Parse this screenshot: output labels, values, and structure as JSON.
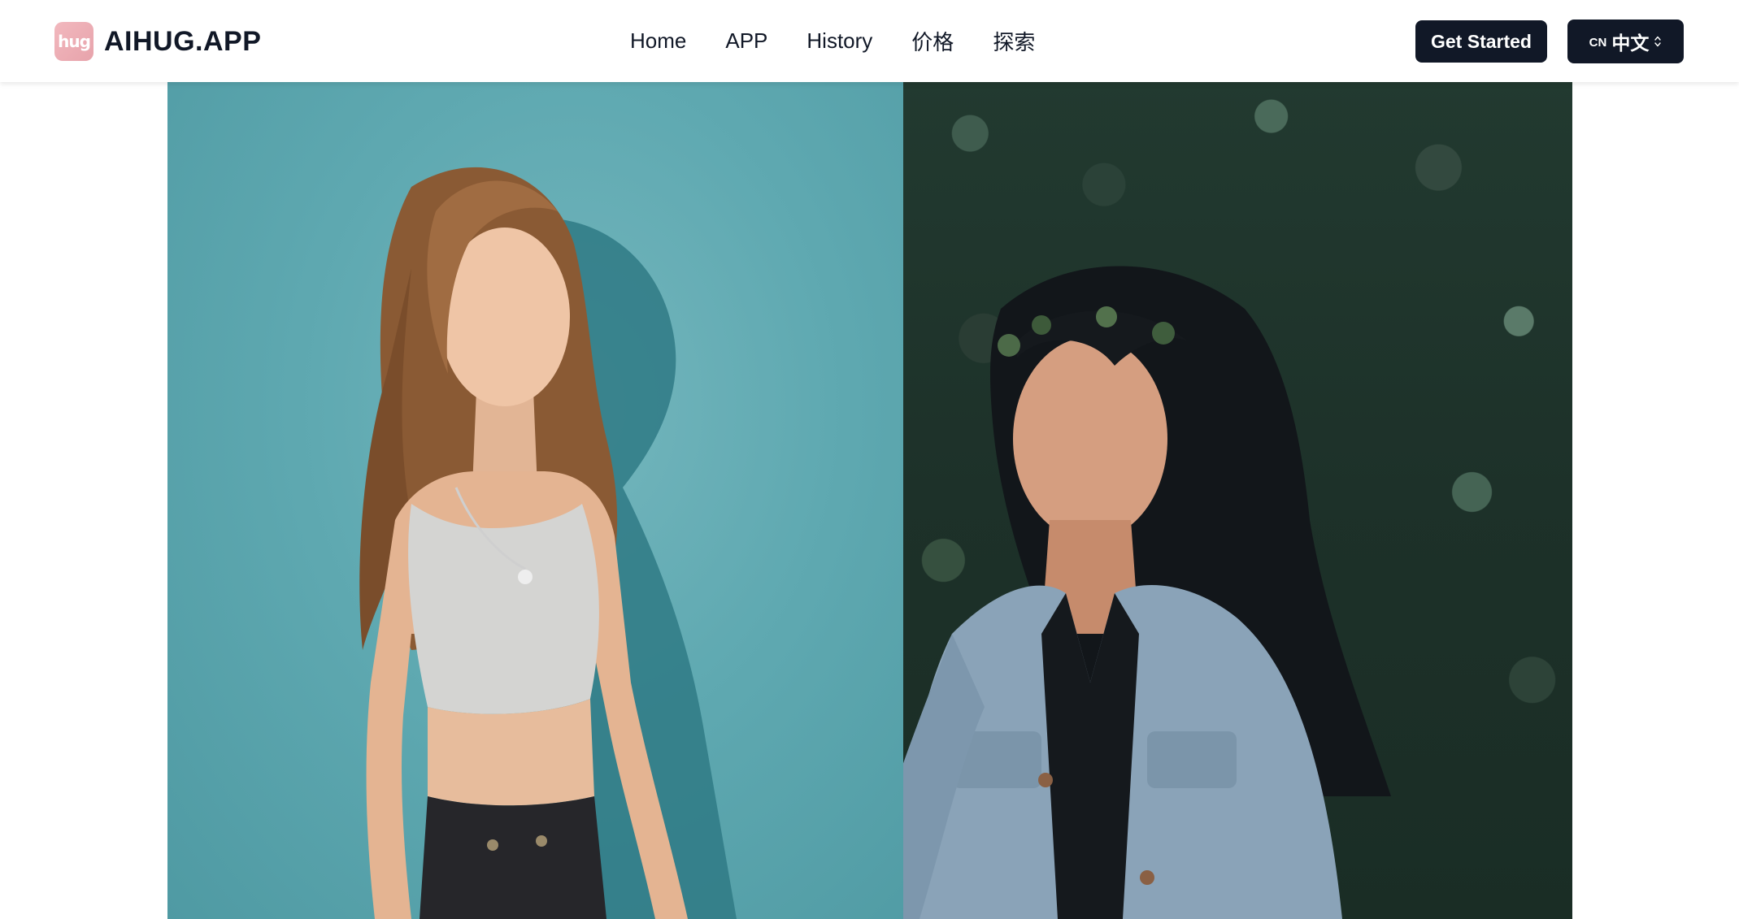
{
  "brand": {
    "logo_text": "hug",
    "name": "AIHUG.APP"
  },
  "nav": {
    "links": [
      {
        "label": "Home"
      },
      {
        "label": "APP"
      },
      {
        "label": "History"
      },
      {
        "label": "价格"
      },
      {
        "label": "探索"
      }
    ]
  },
  "actions": {
    "get_started_label": "Get Started",
    "language": {
      "code": "CN",
      "label": "中文"
    }
  },
  "hero": {
    "media": "two-women-hug-video"
  },
  "colors": {
    "brand_dark": "#111827",
    "logo_pink": "#f2b8be",
    "scene_teal": "#5fa9b1",
    "scene_foliage": "#223a30"
  }
}
